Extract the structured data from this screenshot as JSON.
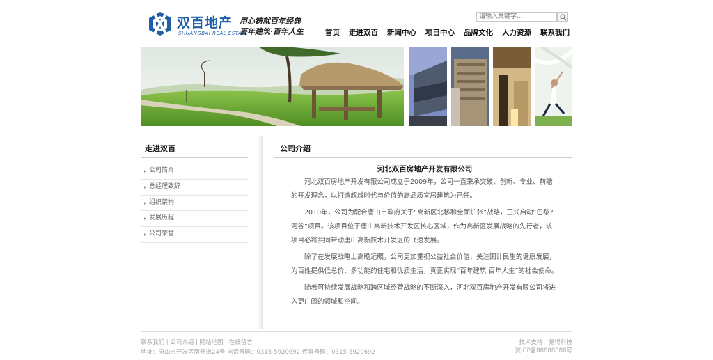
{
  "header": {
    "brand_name": "双百地产",
    "brand_en": "SHUANGBAI REAL ESTATE",
    "slogan_line1": "用心铸就百年经典",
    "slogan_line2": "百年建筑·百年人生",
    "search_placeholder": "请输入关键字..."
  },
  "nav": [
    "首页",
    "走进双百",
    "新闻中心",
    "项目中心",
    "品牌文化",
    "人力资源",
    "联系我们"
  ],
  "sidebar": {
    "title": "走进双百",
    "items": [
      "公司简介",
      "总经理致辞",
      "组织架构",
      "发展历程",
      "公司荣誉"
    ]
  },
  "main": {
    "section_title": "公司介绍",
    "heading": "河北双百房地产开发有限公司",
    "paragraphs": [
      "河北双百房地产开发有限公司成立于2009年，公司一直秉承突破、创新、专业、前瞻的开发理念，以打造超越时代与价值的高品质宜居建筑为己任。",
      "2010年，公司为配合唐山市政府关于“高新区北移和全面扩张”战略，正式启动“巴黎?河谷”项目。该项目位于唐山高新技术开发区核心区域，作为高新区发展战略的先行者，该项目必将共同带动唐山高新技术开发区的飞速发展。",
      "除了在发展战略上高瞻远瞩，公司更加重视公益社会价值，关注国计民生的健康发展，为百姓提供低总价、多功能的住宅和优质生活，真正实现“百年建筑 百年人生”的社会使命。",
      "随着可持续发展战略和跨区域经营战略的不断深入，河北双百房地产开发有限公司将进入更广阔的领域和空间。"
    ]
  },
  "footer": {
    "links": "联系我们 | 公司介绍 | 网站地图 | 在线留言",
    "address": "地址：唐山市开发区南开道24号  电话号码：0315-5920692  传真号码：0315-5920692",
    "tech_support": "技术支持：易得科技",
    "icp": "冀ICP备88888888号"
  },
  "colors": {
    "brand_blue": "#1f5fa8"
  }
}
